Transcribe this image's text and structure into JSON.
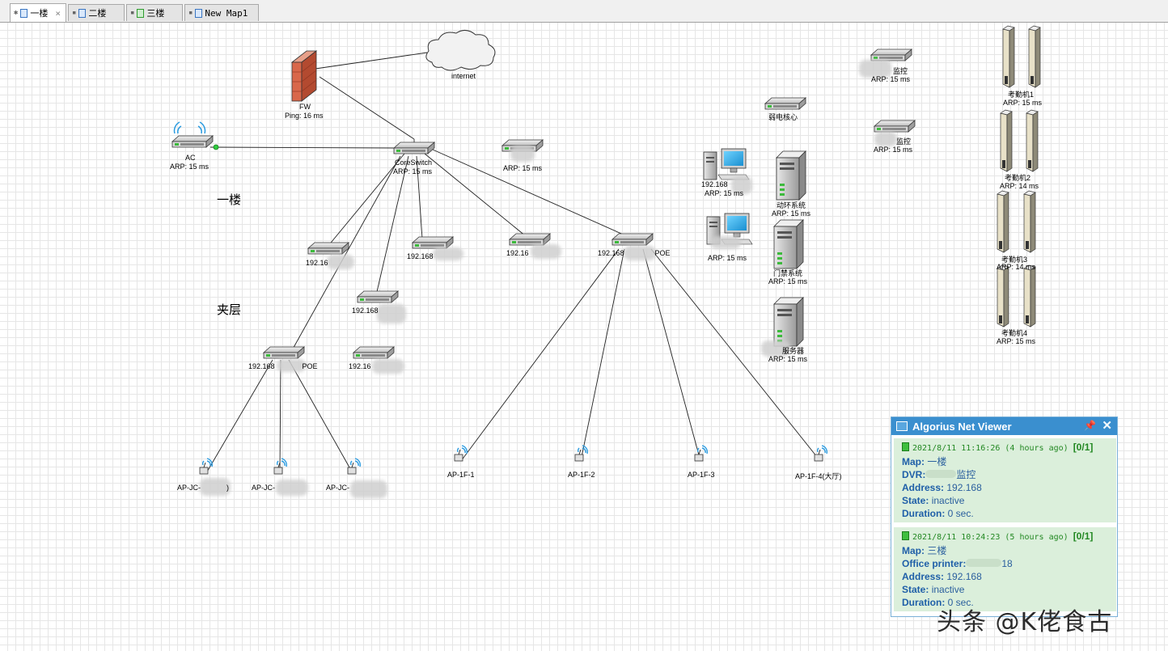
{
  "tabs": [
    {
      "label": "一楼",
      "active": true
    },
    {
      "label": "二楼"
    },
    {
      "label": "三楼"
    },
    {
      "label": "New Map1"
    }
  ],
  "map": {
    "cloud": {
      "label": "internet"
    },
    "fw": {
      "name": "FW",
      "status": "Ping: 16 ms"
    },
    "ac": {
      "name": "AC",
      "status": "ARP: 15 ms"
    },
    "core": {
      "name": "CoreSwitch",
      "status": "ARP: 15 ms"
    },
    "sw_top": {
      "status": "ARP: 15 ms"
    },
    "sw1": {
      "name": "192.16"
    },
    "sw2": {
      "name": "192.168"
    },
    "sw3": {
      "name": "192.16"
    },
    "sw_poe1": {
      "name": "192.168",
      "suffix": "POE"
    },
    "sw4": {
      "name": "192.168"
    },
    "sw_poe2": {
      "name": "192.168",
      "suffix": "POE"
    },
    "sw5": {
      "name": "192.16"
    },
    "floor1": "一楼",
    "mezz": "夹层",
    "ap_jc": [
      "AP-JC-",
      "AP-JC-",
      "AP-JC-"
    ],
    "ap_jc_tail": ")",
    "ap_1f": [
      "AP-1F-1",
      "AP-1F-2",
      "AP-1F-3",
      "AP-1F-4(大厅)"
    ],
    "pc1": {
      "name": "192.168",
      "status": "ARP: 15 ms"
    },
    "pc2": {
      "status": "ARP: 15 ms"
    },
    "weak_core": {
      "name": "弱电核心"
    },
    "srv1": {
      "name": "动环系统",
      "status": "ARP: 15 ms"
    },
    "srv2": {
      "name": "门禁系统",
      "status": "ARP: 15 ms"
    },
    "srv3": {
      "name": "服务器",
      "status": "ARP: 15 ms"
    },
    "dvr1": {
      "name": "监控",
      "status": "ARP: 15 ms"
    },
    "dvr2": {
      "name": "监控",
      "status": "ARP: 15 ms"
    },
    "att": [
      {
        "name": "考勤机1",
        "status": "ARP: 15 ms"
      },
      {
        "name": "考勤机2",
        "status": "ARP: 14 ms"
      },
      {
        "name": "考勤机3",
        "status": "ARP: 14 ms"
      },
      {
        "name": "考勤机4",
        "status": "ARP: 15 ms"
      }
    ]
  },
  "viewer": {
    "title": "Algorius Net Viewer",
    "events": [
      {
        "time": "2021/8/11 11:16:26 (4 hours ago)",
        "count": "[0/1]",
        "map_label": "Map:",
        "map": "一楼",
        "dev_label": "DVR:",
        "dev": "监控",
        "addr_label": "Address:",
        "addr": "192.168",
        "state_label": "State:",
        "state": "inactive",
        "dur_label": "Duration:",
        "dur": "0 sec."
      },
      {
        "time": "2021/8/11 10:24:23 (5 hours ago)",
        "count": "[0/1]",
        "map_label": "Map:",
        "map": "三楼",
        "dev_label": "Office printer:",
        "dev": "18",
        "addr_label": "Address:",
        "addr": "192.168",
        "state_label": "State:",
        "state": "inactive",
        "dur_label": "Duration:",
        "dur": "0 sec."
      }
    ]
  },
  "watermark": "头条 @K佬食古",
  "colors": {
    "accent": "#3a8fcf",
    "card_bg": "#dbefdb",
    "grid": "#e6e6e6"
  }
}
